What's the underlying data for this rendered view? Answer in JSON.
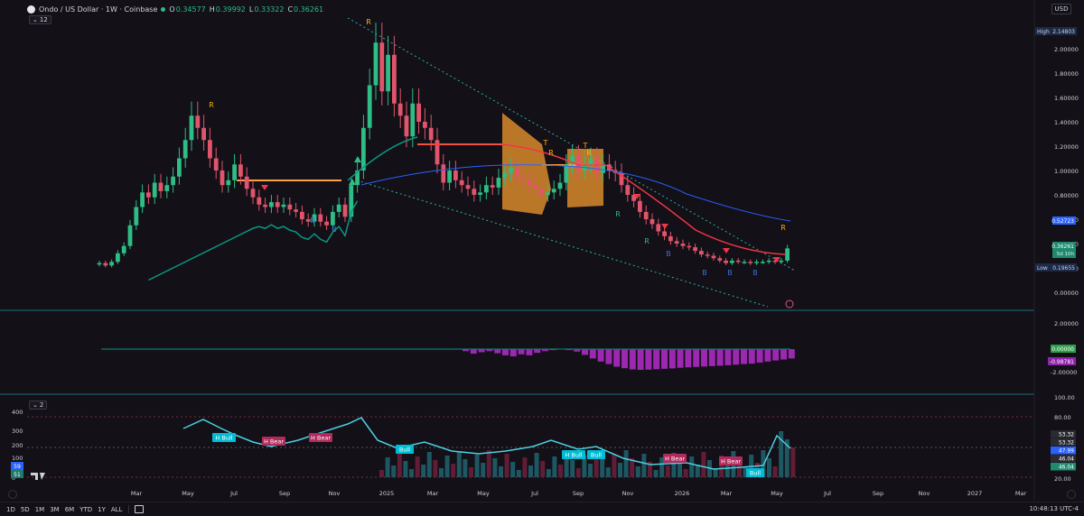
{
  "header": {
    "symbol": "Ondo / US Dollar · 1W · Coinbase",
    "open_label": "O",
    "open": "0.34577",
    "high_label": "H",
    "high": "0.39992",
    "low_label": "L",
    "low": "0.33322",
    "close_label": "C",
    "close": "0.36261",
    "indicator_count_main": "12",
    "indicator_count_lower": "2",
    "currency": "USD"
  },
  "price_axis": {
    "ticks": [
      "2.00000",
      "1.80000",
      "1.60000",
      "1.40000",
      "1.20000",
      "1.00000",
      "0.80000",
      "0.60000",
      "0.40000",
      "0.20000",
      "0.00000"
    ],
    "high_label": "High",
    "high_value": "2.14803",
    "low_label": "Low",
    "low_value": "0.19655",
    "ma_value": "0.52723",
    "last_value": "0.36261",
    "countdown": "5d 10h"
  },
  "osc_axis": {
    "ticks": [
      "2.00000",
      "-2.00000"
    ],
    "zero_value": "0.00000",
    "value": "-0.98781"
  },
  "lower_axis": {
    "ticks": [
      "100.00",
      "80.00",
      "20.00"
    ],
    "values": [
      "53.32",
      "53.32",
      "47.99",
      "46.04",
      "46.04"
    ],
    "left_ticks": [
      "400",
      "300",
      "200",
      "100",
      "0"
    ],
    "left_badge": "59",
    "left_badge2": "51"
  },
  "time_axis": [
    "Mar",
    "May",
    "Jul",
    "Sep",
    "Nov",
    "2025",
    "Mar",
    "May",
    "Jul",
    "Sep",
    "Nov",
    "2026",
    "Mar",
    "May",
    "Jul",
    "Sep",
    "Nov",
    "2027",
    "Mar"
  ],
  "signals": {
    "R": "R",
    "B": "B",
    "T": "T",
    "h_bull": "H Bull",
    "h_bear": "H Bear",
    "bull": "Bull"
  },
  "toolbar": {
    "timeframes": [
      "1D",
      "5D",
      "1M",
      "3M",
      "6M",
      "YTD",
      "1Y",
      "ALL"
    ],
    "clock": "10:48:13 UTC-4"
  },
  "colors": {
    "bull": "#2ebd85",
    "bear": "#e0556b",
    "ema": "#f23645",
    "sma": "#2962ff",
    "trail": "#089981",
    "cloud": "#d9892b",
    "macd": "#9c27b0",
    "rsi": "#4dd0e1",
    "bull_label": "#00bcd4",
    "bear_label": "#b02a5c",
    "orange_line": "#ff9f43",
    "signal_R": "#ffb300"
  },
  "chart_data": {
    "type": "candlestick",
    "title": "Ondo / US Dollar · 1W · Coinbase",
    "x_start": "2024-01-22",
    "x_step_days": 7,
    "x_tick_labels": [
      "Mar",
      "May",
      "Jul",
      "Sep",
      "Nov",
      "2025",
      "Mar",
      "May",
      "Jul",
      "Sep",
      "Nov",
      "2026",
      "Mar",
      "May",
      "Jul",
      "Sep",
      "Nov",
      "2027",
      "Mar"
    ],
    "ylim": [
      0,
      2.3
    ],
    "last": {
      "open": 0.34577,
      "high": 0.39992,
      "low": 0.33322,
      "close": 0.36261
    },
    "price_high": 2.14803,
    "price_low": 0.19655,
    "ma_last": 0.52723,
    "close": [
      0.24,
      0.22,
      0.25,
      0.32,
      0.38,
      0.55,
      0.7,
      0.82,
      0.78,
      0.9,
      0.83,
      0.88,
      0.95,
      1.1,
      1.25,
      1.45,
      1.35,
      1.25,
      1.1,
      1.0,
      0.88,
      0.92,
      1.05,
      0.95,
      0.85,
      0.78,
      0.72,
      0.7,
      0.74,
      0.7,
      0.72,
      0.68,
      0.66,
      0.6,
      0.58,
      0.64,
      0.58,
      0.55,
      0.66,
      0.72,
      0.62,
      0.88,
      1.0,
      1.35,
      1.7,
      2.05,
      1.65,
      1.95,
      1.55,
      1.45,
      1.28,
      1.55,
      1.4,
      1.35,
      1.25,
      1.05,
      0.9,
      1.0,
      0.92,
      0.88,
      0.85,
      0.8,
      0.82,
      0.88,
      0.86,
      0.94,
      0.98,
      1.02,
      0.94,
      0.92,
      0.88,
      0.85,
      0.8,
      0.82,
      0.85,
      0.9,
      1.05,
      1.12,
      1.0,
      1.05,
      1.1,
      0.98,
      1.05,
      1.0,
      0.98,
      0.88,
      0.8,
      0.75,
      0.66,
      0.6,
      0.56,
      0.5,
      0.46,
      0.42,
      0.4,
      0.38,
      0.37,
      0.34,
      0.31,
      0.3,
      0.28,
      0.26,
      0.24,
      0.26,
      0.25,
      0.25,
      0.24,
      0.25,
      0.25,
      0.26,
      0.25,
      0.26,
      0.36
    ],
    "macd_hist": [
      -0.1,
      -0.22,
      -0.15,
      -0.1,
      -0.2,
      -0.3,
      -0.35,
      -0.25,
      -0.3,
      -0.18,
      -0.1,
      -0.05,
      -0.02,
      -0.05,
      -0.12,
      -0.28,
      -0.45,
      -0.6,
      -0.72,
      -0.85,
      -0.92,
      -0.98,
      -1.0,
      -0.99,
      -0.97,
      -0.95,
      -0.93,
      -0.9,
      -0.88,
      -0.86,
      -0.84,
      -0.82,
      -0.8,
      -0.78,
      -0.75,
      -0.72,
      -0.7,
      -0.65,
      -0.6,
      -0.55,
      -0.5,
      -0.45
    ],
    "rsi_value": 47.99,
    "rsi_levels": [
      80,
      20
    ]
  }
}
